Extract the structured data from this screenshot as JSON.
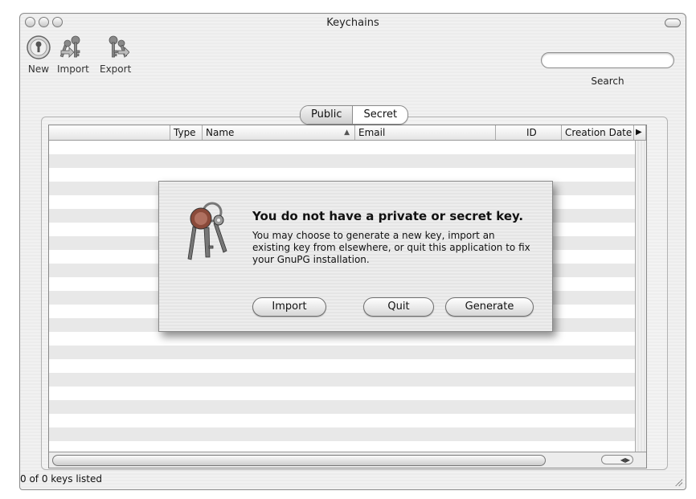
{
  "window": {
    "title": "Keychains"
  },
  "toolbar": {
    "items": [
      {
        "label": "New",
        "icon": "key-hole-icon"
      },
      {
        "label": "Import",
        "icon": "keys-import-icon"
      },
      {
        "label": "Export",
        "icon": "keys-export-icon"
      }
    ],
    "search": {
      "label": "Search",
      "value": ""
    }
  },
  "segmented": {
    "public_label": "Public",
    "secret_label": "Secret",
    "selected": "Public"
  },
  "table": {
    "columns": [
      "",
      "Type",
      "Name",
      "Email",
      "ID",
      "Creation Date"
    ],
    "sorted_column": "Name",
    "rows": []
  },
  "dialog": {
    "title": "You do not have a private or secret key.",
    "message": "You may choose to generate a new key, import an existing key from elsewhere, or quit this application to fix your GnuPG installation.",
    "buttons": {
      "import": "Import",
      "quit": "Quit",
      "generate": "Generate"
    }
  },
  "status": {
    "text": "0 of 0 keys listed"
  }
}
